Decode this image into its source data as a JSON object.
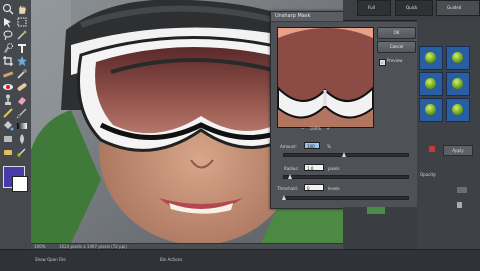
{
  "dialog": {
    "title": "Unsharp Mask",
    "ok_label": "OK",
    "cancel_label": "Cancel",
    "preview_label": "Preview",
    "preview_checked": true,
    "zoom_label": "100%",
    "amount_label": "Amount:",
    "amount_value": "100",
    "amount_unit": "%",
    "radius_label": "Radius:",
    "radius_value": "1.0",
    "radius_unit": "pixels",
    "threshold_label": "Threshold:",
    "threshold_value": "0",
    "threshold_unit": "levels"
  },
  "status": {
    "zoom": "100%",
    "doc_info": "1024 pixels x 1497 pixels (72 ppi)"
  },
  "bottom_bar": {
    "left_label": "Show Open File",
    "right_label": "Bin Actions"
  },
  "right_tabs": [
    {
      "label": "Full"
    },
    {
      "label": "Quick"
    },
    {
      "label": "Guided"
    }
  ],
  "right_panel": {
    "apply_label": "Apply",
    "opacity_label": "Opacity:"
  },
  "colors": {
    "foreground_swatch": "#4a39a8",
    "accent": "#2a5ea3"
  }
}
